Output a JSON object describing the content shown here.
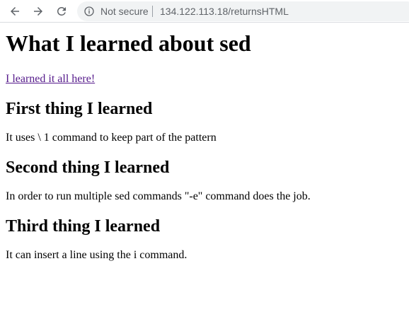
{
  "browser": {
    "security_label": "Not secure",
    "url": "134.122.113.18/returnsHTML",
    "icons": {
      "back": "back-arrow-icon",
      "forward": "forward-arrow-icon",
      "reload": "reload-icon",
      "info": "info-icon"
    }
  },
  "page": {
    "title": "What I learned about sed",
    "link_text": "I learned it all here!",
    "sections": [
      {
        "heading": "First thing I learned",
        "text": "It uses \\ 1 command to keep part of the pattern"
      },
      {
        "heading": "Second thing I learned",
        "text": "In order to run multiple sed commands \"-e\" command does the job."
      },
      {
        "heading": "Third thing I learned",
        "text": "It can insert a line using the i command."
      }
    ]
  },
  "colors": {
    "visited_link": "#551a8b",
    "omnibox_bg": "#f1f3f4",
    "toolbar_icon": "#5f6368"
  }
}
